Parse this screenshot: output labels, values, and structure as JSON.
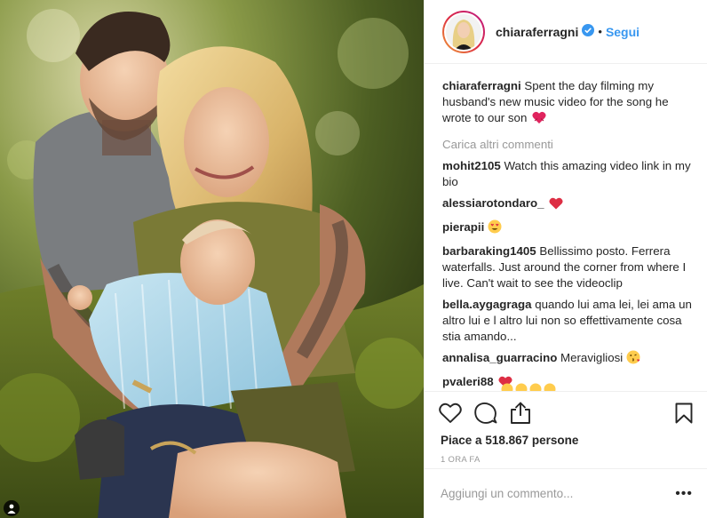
{
  "header": {
    "username": "chiaraferragni",
    "separator": "•",
    "follow_label": "Segui"
  },
  "caption": {
    "username": "chiaraferragni",
    "text": "Spent the day filming my husband's new music video for the song he wrote to our son",
    "emoji": "heart-icon"
  },
  "load_more_label": "Carica altri commenti",
  "comments": [
    {
      "user": "mohit2105",
      "text": "Watch this amazing video link in my bio"
    },
    {
      "user": "alessiarotondaro_",
      "text": ""
    },
    {
      "user": "pierapii",
      "text": ""
    },
    {
      "user": "barbaraking1405",
      "text": "Bellissimo posto. Ferrera waterfalls. Just around the corner from where I live. Can't wait to see the videoclip"
    },
    {
      "user": "bella.aygagraga",
      "text": "quando lui ama lei, lei ama un altro lui e l altro lui non so effettivamente cosa stia amando..."
    },
    {
      "user": "annalisa_guarracino",
      "text": "Meravigliosi"
    },
    {
      "user": "pvaleri88",
      "text": ""
    }
  ],
  "likes": {
    "label": "Piace a",
    "count": "518.867",
    "suffix": "persone"
  },
  "time_ago": "1 ORA FA",
  "add_comment_placeholder": "Aggiungi un commento...",
  "more_dots": "•••",
  "colors": {
    "accent": "#3897f0",
    "heart": "#ed4956",
    "text": "#262626",
    "muted": "#999999"
  }
}
